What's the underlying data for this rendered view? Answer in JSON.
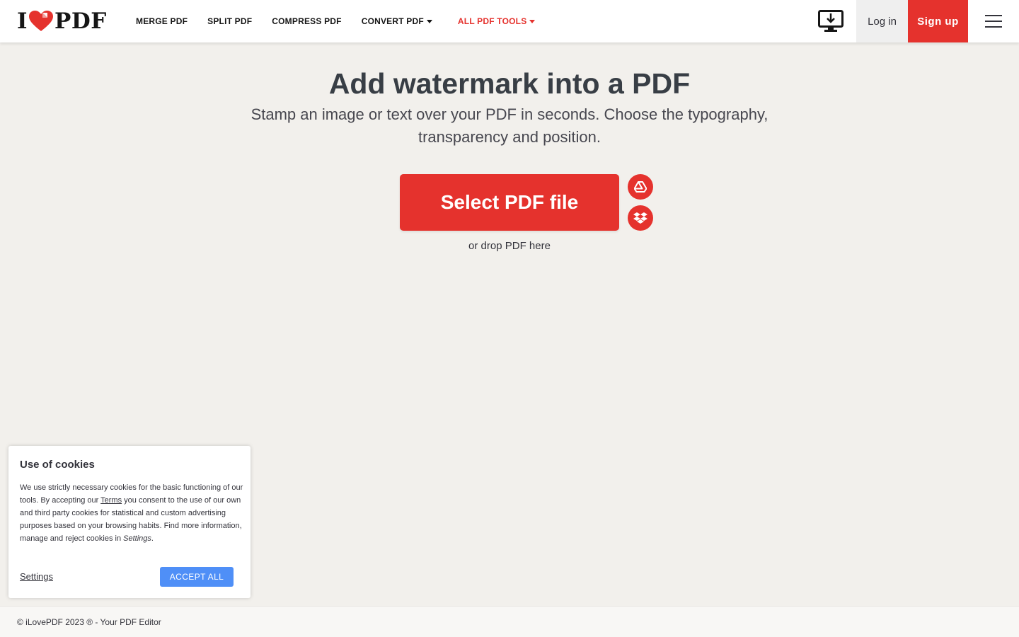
{
  "colors": {
    "brand": "#e5322d",
    "accept_button": "#4f8ff7",
    "page_background": "#f2f0ec",
    "text": "#33333b"
  },
  "header": {
    "logo": {
      "left": "I",
      "heart_icon": "heart-icon",
      "right": "PDF"
    },
    "nav": [
      {
        "label": "MERGE PDF",
        "has_caret": false
      },
      {
        "label": "SPLIT PDF",
        "has_caret": false
      },
      {
        "label": "COMPRESS PDF",
        "has_caret": false
      },
      {
        "label": "CONVERT PDF",
        "has_caret": true
      },
      {
        "label": "ALL PDF TOOLS",
        "has_caret": true
      }
    ],
    "desktop_icon": "desktop-download-icon",
    "login_label": "Log in",
    "signup_label": "Sign up",
    "menu_icon": "hamburger-menu-icon"
  },
  "main": {
    "title": "Add watermark into a PDF",
    "subtitle": "Stamp an image or text over your PDF in seconds. Choose the typography, transparency and position.",
    "select_button": "Select PDF file",
    "cloud_icons": [
      "google-drive-icon",
      "dropbox-icon"
    ],
    "drop_hint": "or drop PDF here"
  },
  "cookie": {
    "title": "Use of cookies",
    "text_1": "We use strictly necessary cookies for the basic functioning of our tools. By accepting our ",
    "terms_link": "Terms",
    "text_2": " you consent to the use of our own and third party cookies for statistical and custom advertising purposes based on your browsing habits. Find more information, manage and reject cookies in ",
    "settings_inline": "Settings",
    "text_3": ".",
    "settings_link": "Settings",
    "accept_label": "ACCEPT ALL"
  },
  "footer": {
    "text": "© iLovePDF 2023 ® - Your PDF Editor"
  }
}
